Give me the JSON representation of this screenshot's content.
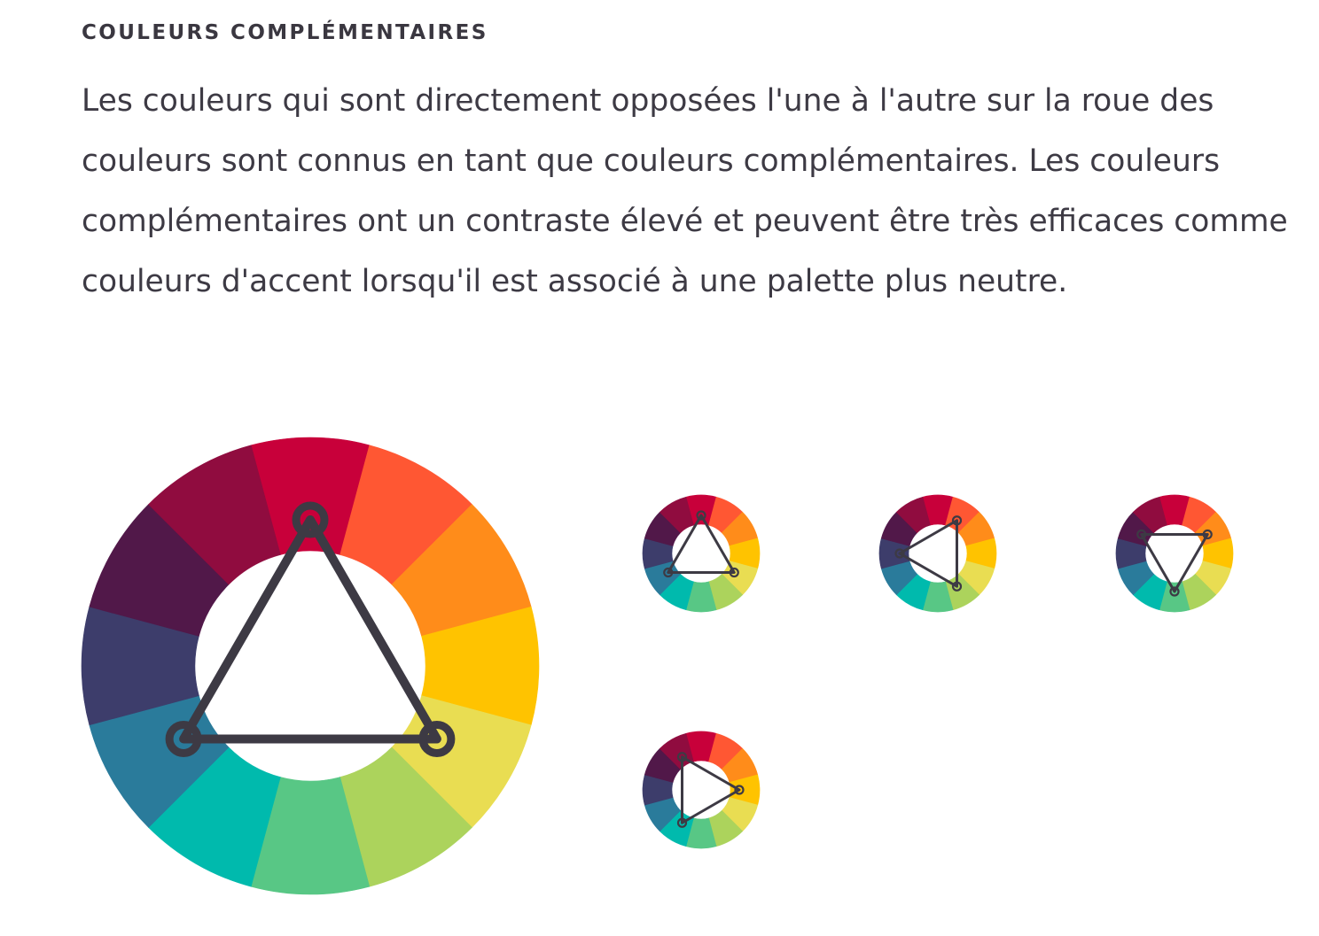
{
  "section": {
    "title": "COULEURS COMPLÉMENTAIRES",
    "description": "Les couleurs qui sont directement opposées l'une à l'autre sur la roue des couleurs sont connus en tant que couleurs complémentaires. Les couleurs complémentaires ont un contraste élevé et peuvent être très efficaces comme couleurs d'accent lorsqu'il est associé à une palette plus neutre."
  },
  "color_wheel": {
    "segment_colors": [
      "#c8003a",
      "#ff5733",
      "#ff8c1a",
      "#ffc300",
      "#e9dd52",
      "#acd35c",
      "#58c785",
      "#00baad",
      "#2a7b9b",
      "#3d3d6b",
      "#511849",
      "#900c3f"
    ],
    "line_color": "#3d3a44"
  },
  "wheels": [
    {
      "name": "wheel-large",
      "selected_segments": [
        0,
        4,
        8
      ]
    },
    {
      "name": "wheel-a",
      "selected_segments": [
        0,
        4,
        8
      ]
    },
    {
      "name": "wheel-b",
      "selected_segments": [
        1,
        5,
        9
      ]
    },
    {
      "name": "wheel-c",
      "selected_segments": [
        2,
        6,
        10
      ]
    },
    {
      "name": "wheel-d",
      "selected_segments": [
        3,
        7,
        11
      ]
    }
  ]
}
